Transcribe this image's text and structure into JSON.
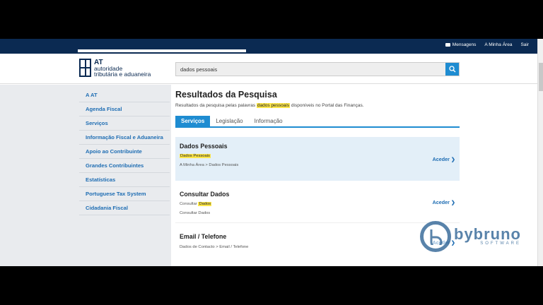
{
  "topbar": {
    "links": [
      {
        "label": "Mensagens",
        "icon": "envelope-icon"
      },
      {
        "label": "A Minha Área"
      },
      {
        "label": "Sair"
      }
    ]
  },
  "logo": {
    "line1": "AT",
    "line2": "autoridade",
    "line3": "tributária e aduaneira"
  },
  "search": {
    "value": "dados pessoais",
    "icon": "search-icon"
  },
  "sidebar": {
    "items": [
      {
        "label": "A AT"
      },
      {
        "label": "Agenda Fiscal"
      },
      {
        "label": "Serviços"
      },
      {
        "label": "Informação Fiscal e Aduaneira"
      },
      {
        "label": "Apoio ao Contribuinte"
      },
      {
        "label": "Grandes Contribuintes"
      },
      {
        "label": "Estatísticas"
      },
      {
        "label": "Portuguese Tax System"
      },
      {
        "label": "Cidadania Fiscal"
      }
    ]
  },
  "main": {
    "title": "Resultados da Pesquisa",
    "subtitle_pre": "Resultados da pesquisa pelas palavras",
    "subtitle_highlight": "dados pessoais",
    "subtitle_post": "disponíveis no Portal das Finanças.",
    "tabs": [
      {
        "label": "Serviços",
        "active": true
      },
      {
        "label": "Legislação"
      },
      {
        "label": "Informação"
      }
    ]
  },
  "results": [
    {
      "title": "Dados Pessoais",
      "snippet_pre": "",
      "snippet_highlight": "Dados Pessoais",
      "path": "A Minha Área > Dados Pessoais",
      "action": "Aceder ❯"
    },
    {
      "title": "Consultar Dados",
      "snippet_pre": "Consultar",
      "snippet_highlight": "Dados",
      "path": "Consultar Dados",
      "action": "Aceder ❯"
    },
    {
      "title": "Email / Telefone",
      "path": "Dados de Contacto > Email / Telefone",
      "action": "Aceder ❯"
    }
  ],
  "watermark": {
    "text": "bybruno",
    "sub": "SOFTWARE"
  },
  "colors": {
    "navy": "#0b2a52",
    "accent": "#1e8cd1",
    "link": "#1e6db3",
    "highlight": "#fce64a"
  }
}
